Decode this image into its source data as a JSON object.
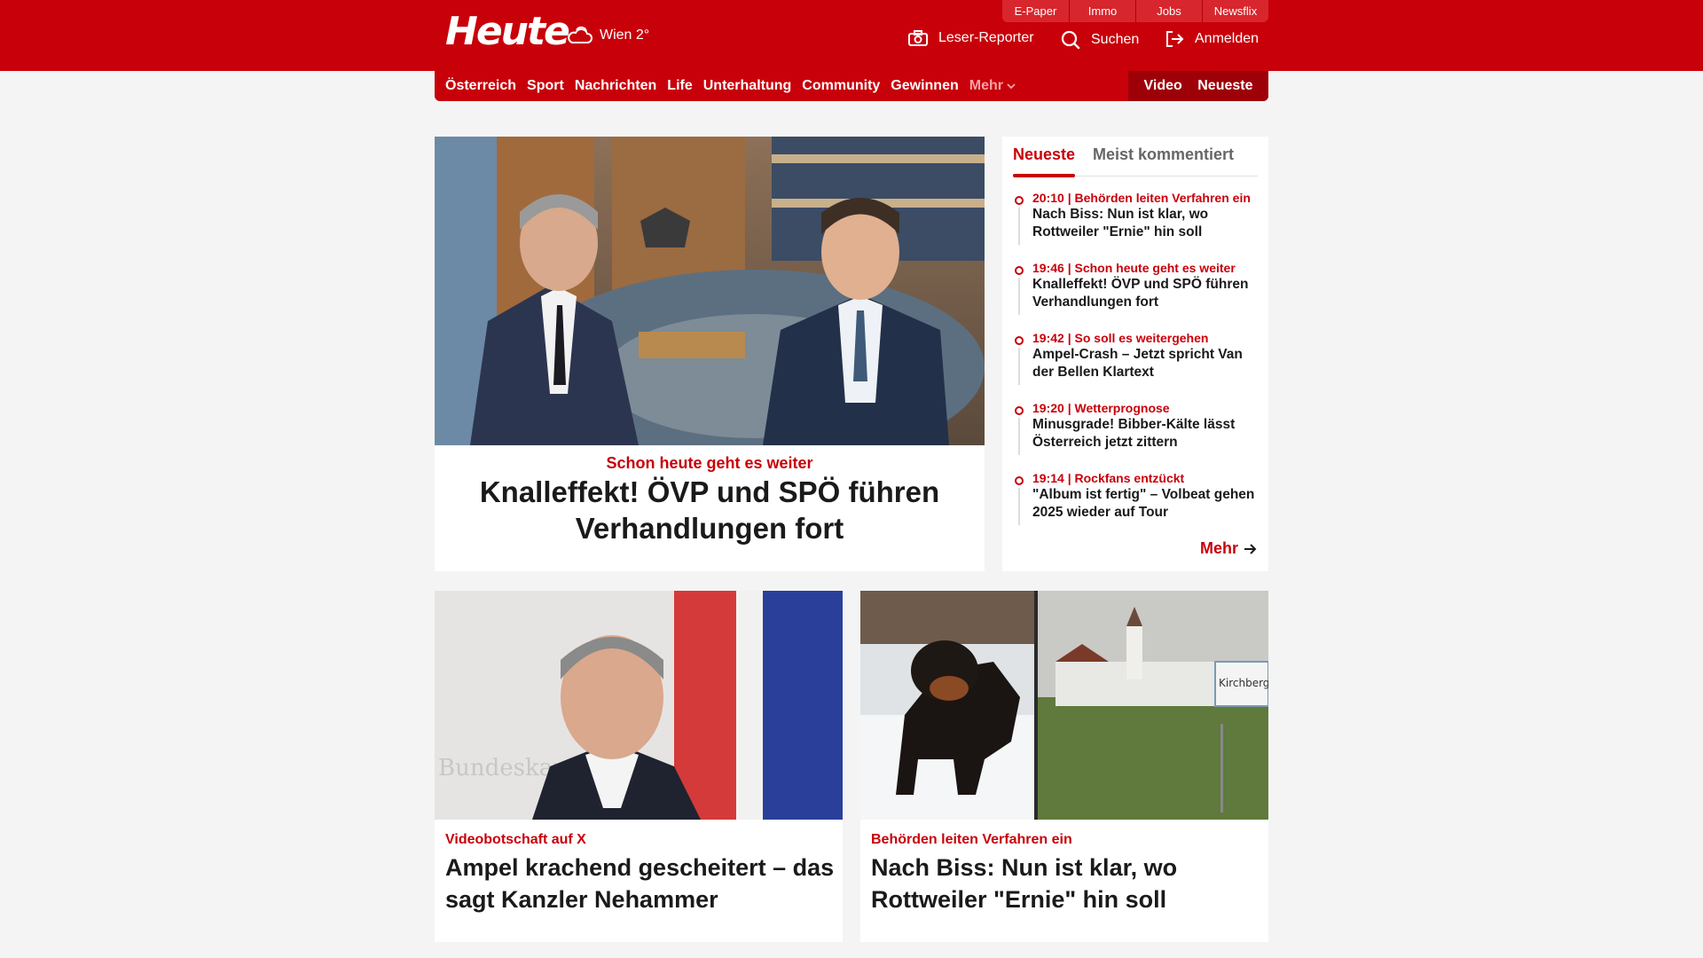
{
  "header": {
    "logo": "Heute",
    "weather": "Wien 2°",
    "util_links": [
      "E-Paper",
      "Immo",
      "Jobs",
      "Newsflix"
    ],
    "actions": {
      "reporter": "Leser-Reporter",
      "search": "Suchen",
      "login": "Anmelden"
    },
    "brand_color": "#c8000a"
  },
  "nav": {
    "items": [
      "Österreich",
      "Sport",
      "Nachrichten",
      "Life",
      "Unterhaltung",
      "Community",
      "Gewinnen"
    ],
    "more": "Mehr",
    "right": [
      "Video",
      "Neueste"
    ]
  },
  "hero": {
    "kicker": "Schon heute geht es weiter",
    "title": "Knalleffekt! ÖVP und SPÖ führen Verhandlungen fort"
  },
  "sidebar": {
    "tabs": [
      "Neueste",
      "Meist kommentiert"
    ],
    "items": [
      {
        "meta": "20:10 | Behörden leiten Verfahren ein",
        "title": "Nach Biss: Nun ist klar, wo Rottweiler \"Ernie\" hin soll"
      },
      {
        "meta": "19:46 | Schon heute geht es weiter",
        "title": "Knalleffekt! ÖVP und SPÖ führen Verhandlungen fort"
      },
      {
        "meta": "19:42 | So soll es weitergehen",
        "title": "Ampel-Crash – Jetzt spricht Van der Bellen Klartext"
      },
      {
        "meta": "19:20 | Wetterprognose",
        "title": "Minusgrade! Bibber-Kälte lässt Österreich jetzt zittern"
      },
      {
        "meta": "19:14 | Rockfans entzückt",
        "title": "\"Album ist fertig\" – Volbeat gehen 2025 wieder auf Tour"
      }
    ],
    "more": "Mehr"
  },
  "cards": [
    {
      "kicker": "Videobotschaft auf X",
      "title": "Ampel krachend gescheitert – das sagt Kanzler Nehammer"
    },
    {
      "kicker": "Behörden leiten Verfahren ein",
      "title": "Nach Biss: Nun ist klar, wo Rottweiler \"Ernie\" hin soll",
      "sign_text": "Kirchberg"
    }
  ]
}
